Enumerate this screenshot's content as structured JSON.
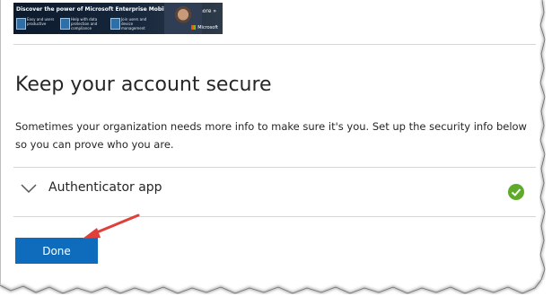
{
  "banner": {
    "title": "Discover the power of Microsoft Enterprise Mobility",
    "learn_more": "Learn more »",
    "features": [
      "Easy and users productive",
      "Help with data protection and compliance",
      "Join users and device management"
    ],
    "brand": "Microsoft"
  },
  "page": {
    "title": "Keep your account secure",
    "description": "Sometimes your organization needs more info to make sure it's you. Set up the security info below so you can prove who you are."
  },
  "methods": [
    {
      "label": "Authenticator app",
      "status": "verified"
    }
  ],
  "actions": {
    "done_label": "Done"
  },
  "colors": {
    "accent": "#0f6cbd",
    "success": "#5fa92b",
    "annotation_arrow": "#e0403a"
  },
  "icons": {
    "expand": "chevron-down-icon",
    "status": "check-circle-icon",
    "annotation": "red-arrow-icon"
  }
}
